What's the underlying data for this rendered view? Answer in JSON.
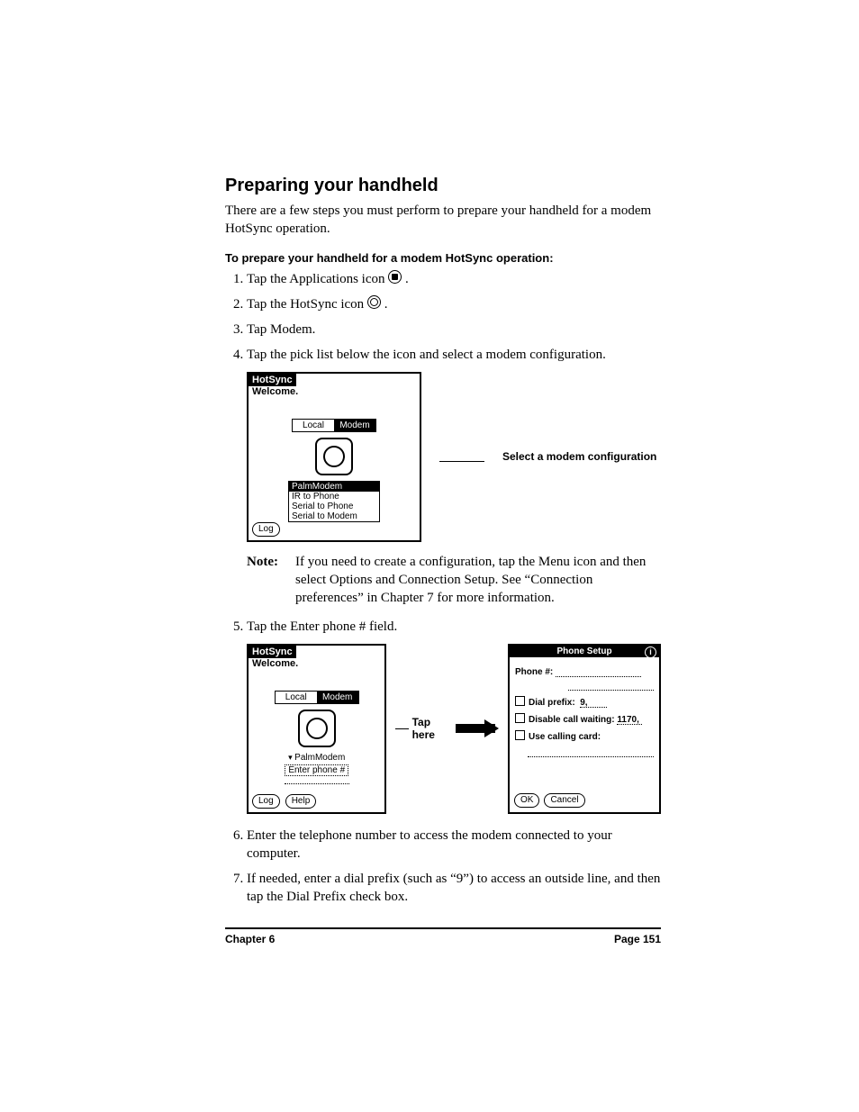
{
  "heading": "Preparing your handheld",
  "intro": "There are a few steps you must perform to prepare your handheld for a modem HotSync operation.",
  "subhead": "To prepare your handheld for a modem HotSync operation:",
  "steps": {
    "s1a": "Tap the Applications icon ",
    "s1b": ".",
    "s2a": "Tap the HotSync icon ",
    "s2b": ".",
    "s3": "Tap Modem.",
    "s4": "Tap the pick list below the icon and select a modem configuration.",
    "s5": "Tap the Enter phone # field.",
    "s6": "Enter the telephone number to access the modem connected to your computer.",
    "s7": "If needed, enter a dial prefix (such as “9”) to access an outside line, and then tap the Dial Prefix check box."
  },
  "fig1": {
    "title": "HotSync",
    "welcome": "Welcome.",
    "tab_local": "Local",
    "tab_modem": "Modem",
    "picklist": {
      "selected": "PalmModem",
      "o1": "IR to Phone",
      "o2": "Serial to Phone",
      "o3": "Serial to Modem"
    },
    "log": "Log",
    "callout": "Select a modem configuration"
  },
  "note": {
    "label": "Note:",
    "text": "If you need to create a configuration, tap the Menu icon and then select Options and Connection Setup. See “Connection preferences” in Chapter 7 for more information."
  },
  "fig2": {
    "left": {
      "title": "HotSync",
      "welcome": "Welcome.",
      "tab_local": "Local",
      "tab_modem": "Modem",
      "pick": "PalmModem",
      "enter": "Enter phone #",
      "log": "Log",
      "help": "Help"
    },
    "tap": "Tap here",
    "right": {
      "title": "Phone Setup",
      "phone": "Phone #:",
      "dial": "Dial prefix:",
      "dial_val": "9,",
      "dcw": "Disable call waiting:",
      "dcw_val": "1170,",
      "card": "Use calling card:",
      "ok": "OK",
      "cancel": "Cancel"
    }
  },
  "footer": {
    "chapter": "Chapter 6",
    "page": "Page 151"
  }
}
